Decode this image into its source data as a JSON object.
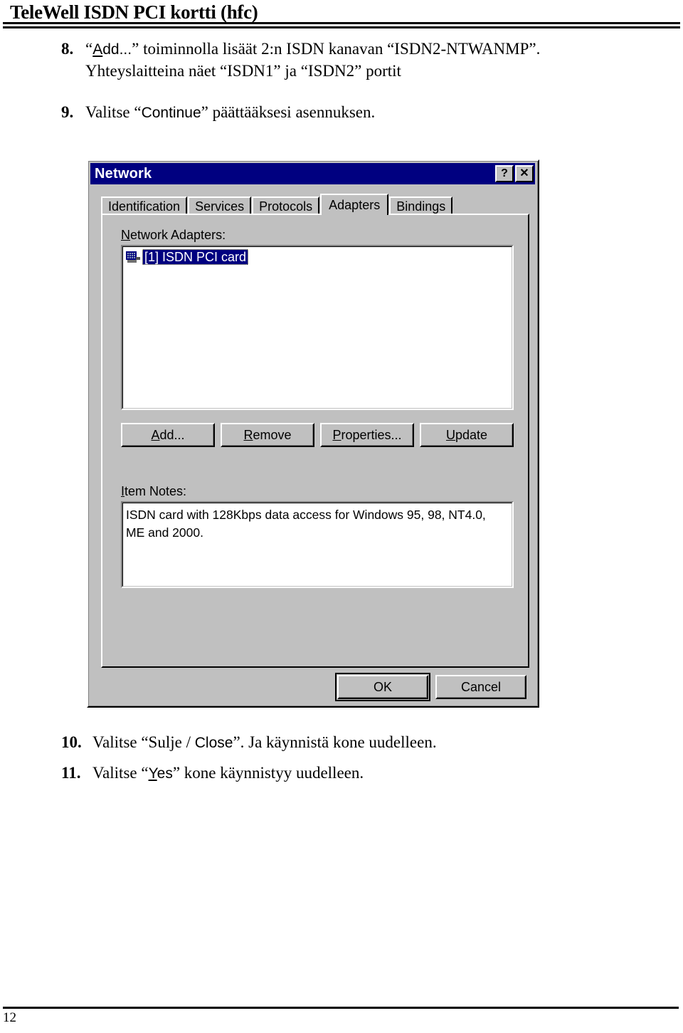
{
  "header": {
    "title": "TeleWell ISDN PCI kortti (hfc)"
  },
  "steps_top": [
    {
      "number": "8.",
      "lines": [
        {
          "parts": [
            {
              "text": "“",
              "style": "serif"
            },
            {
              "text": "A",
              "style": "sans-underline"
            },
            {
              "text": "dd...",
              "style": "sans"
            },
            {
              "text": "” toiminnolla lisäät 2:n ISDN kanavan  “ISDN2-NTWANMP”.",
              "style": "serif"
            }
          ]
        },
        {
          "parts": [
            {
              "text": "Yhteyslaitteina näet “ISDN1” ja “ISDN2” portit",
              "style": "serif"
            }
          ]
        }
      ]
    },
    {
      "number": "9.",
      "lines": [
        {
          "parts": [
            {
              "text": "Valitse “",
              "style": "serif"
            },
            {
              "text": "Continue",
              "style": "sans"
            },
            {
              "text": "” päättääksesi asennuksen.",
              "style": "serif"
            }
          ]
        }
      ]
    }
  ],
  "steps_bottom": [
    {
      "number": "10.",
      "lines": [
        {
          "parts": [
            {
              "text": "Valitse “Sulje / ",
              "style": "serif"
            },
            {
              "text": "Close",
              "style": "sans"
            },
            {
              "text": "”. Ja käynnistä kone uudelleen.",
              "style": "serif"
            }
          ]
        }
      ]
    },
    {
      "number": "11.",
      "lines": [
        {
          "parts": [
            {
              "text": "Valitse “",
              "style": "serif"
            },
            {
              "text": "Y",
              "style": "sans-underline"
            },
            {
              "text": "es",
              "style": "sans"
            },
            {
              "text": "” kone käynnistyy uudelleen.",
              "style": "serif"
            }
          ]
        }
      ]
    }
  ],
  "footer": {
    "page_number": "12"
  },
  "dialog": {
    "title": "Network",
    "titlebar_buttons": [
      {
        "name": "help-button",
        "glyph": "?"
      },
      {
        "name": "close-button",
        "glyph": "✕"
      }
    ],
    "tabs": [
      {
        "label": "Identification",
        "active": false
      },
      {
        "label": "Services",
        "active": false
      },
      {
        "label": "Protocols",
        "active": false
      },
      {
        "label": "Adapters",
        "active": true
      },
      {
        "label": "Bindings",
        "active": false
      }
    ],
    "adapters_label": "Network Adapters:",
    "adapters": [
      {
        "label": "[1] ISDN PCI card",
        "selected": true,
        "icon": "network-card-icon"
      }
    ],
    "action_buttons": [
      {
        "label": "Add...",
        "accel": "A"
      },
      {
        "label": "Remove",
        "accel": "R"
      },
      {
        "label": "Properties...",
        "accel": "P"
      },
      {
        "label": "Update",
        "accel": "U"
      }
    ],
    "notes_label": "Item Notes:",
    "notes_lines": [
      "ISDN card with 128Kbps data access for Windows 95, 98, NT4.0,",
      "ME and 2000."
    ],
    "dialog_buttons": [
      {
        "label": "OK",
        "default": true
      },
      {
        "label": "Cancel",
        "default": false
      }
    ],
    "colors": {
      "titlebar": "#000080",
      "face": "#c0c0c0",
      "selection": "#000080",
      "window": "#ffffff"
    }
  }
}
